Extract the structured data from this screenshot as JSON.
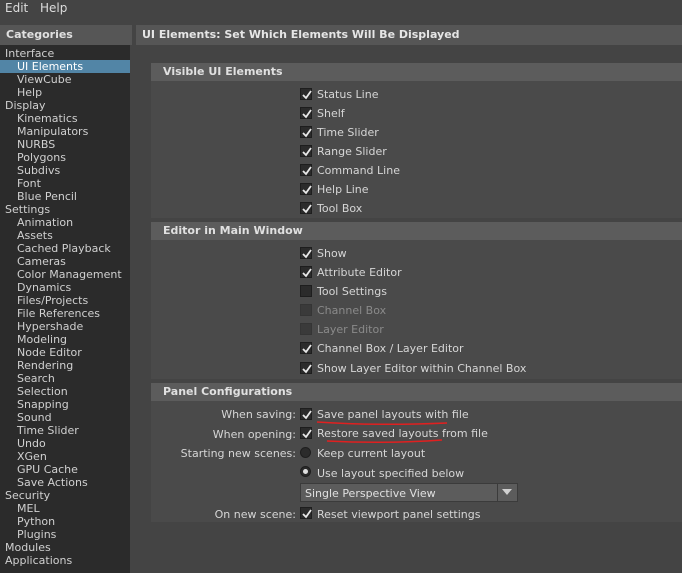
{
  "menu": {
    "edit": "Edit",
    "help": "Help"
  },
  "sidebar": {
    "title": "Categories",
    "items": [
      "Interface",
      "UI Elements",
      "ViewCube",
      "Help",
      "Display",
      "Kinematics",
      "Manipulators",
      "NURBS",
      "Polygons",
      "Subdivs",
      "Font",
      "Blue Pencil",
      "Settings",
      "Animation",
      "Assets",
      "Cached Playback",
      "Cameras",
      "Color Management",
      "Dynamics",
      "Files/Projects",
      "File References",
      "Hypershade",
      "Modeling",
      "Node Editor",
      "Rendering",
      "Search",
      "Selection",
      "Snapping",
      "Sound",
      "Time Slider",
      "Undo",
      "XGen",
      "GPU Cache",
      "Save Actions",
      "Security",
      "MEL",
      "Python",
      "Plugins",
      "Modules",
      "Applications"
    ],
    "selected": "UI Elements"
  },
  "header": {
    "title": "UI Elements: Set Which Elements Will Be Displayed"
  },
  "visible": {
    "title": "Visible UI Elements",
    "items": [
      {
        "label": "Status Line",
        "checked": true
      },
      {
        "label": "Shelf",
        "checked": true
      },
      {
        "label": "Time Slider",
        "checked": true
      },
      {
        "label": "Range Slider",
        "checked": true
      },
      {
        "label": "Command Line",
        "checked": true
      },
      {
        "label": "Help Line",
        "checked": true
      },
      {
        "label": "Tool Box",
        "checked": true
      }
    ]
  },
  "editor": {
    "title": "Editor in Main Window",
    "items": [
      {
        "label": "Show",
        "checked": true
      },
      {
        "label": "Attribute Editor",
        "checked": true
      },
      {
        "label": "Tool Settings",
        "checked": false
      },
      {
        "label": "Channel Box",
        "checked": false,
        "disabled": true
      },
      {
        "label": "Layer Editor",
        "checked": false,
        "disabled": true
      },
      {
        "label": "Channel Box / Layer Editor",
        "checked": true
      },
      {
        "label": "Show Layer Editor within Channel Box",
        "checked": true
      }
    ]
  },
  "panel": {
    "title": "Panel Configurations",
    "when_saving": "When saving:",
    "save_label": "Save panel layouts with file",
    "when_opening": "When opening:",
    "restore_label": "Restore saved layouts from file",
    "starting": "Starting new scenes:",
    "keep_label": "Keep current layout",
    "use_label": "Use layout specified below",
    "dropdown_value": "Single Perspective View",
    "on_new": "On new scene:",
    "reset_label": "Reset viewport panel settings"
  },
  "colors": {
    "selection": "#5285a6",
    "annotation": "#e02020"
  }
}
